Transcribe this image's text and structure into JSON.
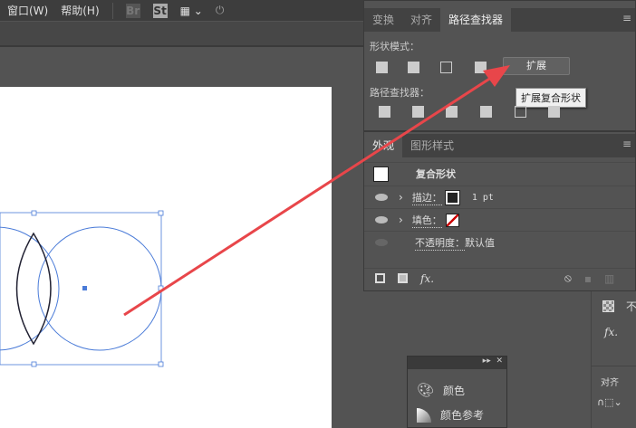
{
  "menu": {
    "window": "窗口(W)",
    "help": "帮助(H)",
    "br": "Br",
    "st": "St"
  },
  "pathfinder_panel": {
    "tabs": [
      "变换",
      "对齐",
      "路径查找器"
    ],
    "shape_modes_label": "形状模式：",
    "expand_button": "扩展",
    "tooltip": "扩展复合形状",
    "pathfinders_label": "路径查找器："
  },
  "appearance_panel": {
    "tabs": [
      "外观",
      "图形样式"
    ],
    "object": "复合形状",
    "stroke_label": "描边：",
    "stroke_value": "1 pt",
    "fill_label": "填色：",
    "opacity_label": "不透明度：",
    "opacity_value": "默认值",
    "fx": "fx."
  },
  "float_panel": {
    "items": [
      "颜色",
      "颜色参考"
    ]
  },
  "right_strip": {
    "fx": "fx.",
    "align": "对齐",
    "opacity_partial": "不"
  },
  "colors": {
    "arrow": "#e8464a",
    "selection": "#4a7bd8"
  }
}
